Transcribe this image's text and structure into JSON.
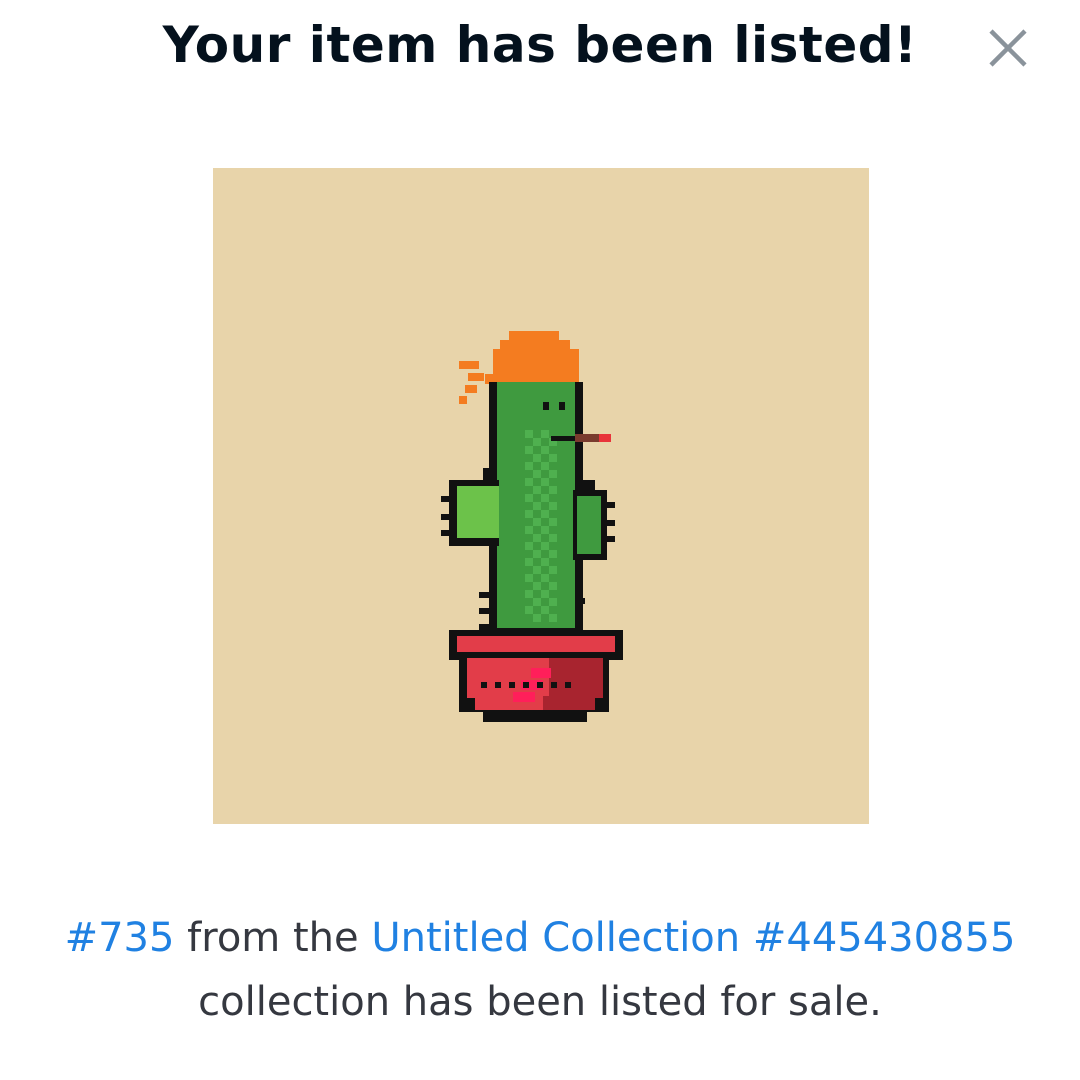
{
  "modal": {
    "title": "Your item has been listed!",
    "close_icon": "close-icon"
  },
  "artwork": {
    "description_icon": "pixel-cactus-in-pot",
    "background_color": "#e8d4aa"
  },
  "message": {
    "item_link": "#735",
    "from_text": " from the ",
    "collection_link": "Untitled Collection #445430855",
    "suffix_text": "collection has been listed for sale."
  },
  "colors": {
    "title": "#04111d",
    "text": "#353840",
    "link": "#2081e2",
    "close": "#8a939b"
  }
}
